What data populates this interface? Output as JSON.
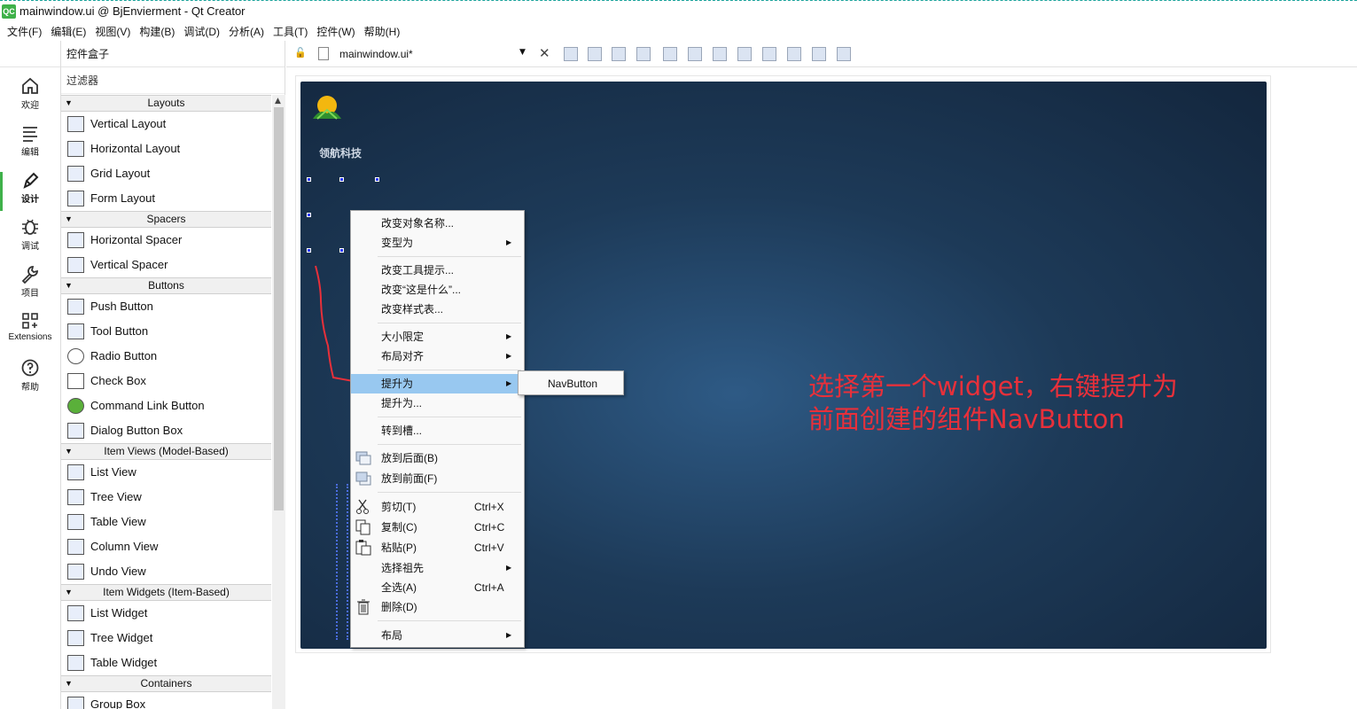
{
  "window": {
    "title": "mainwindow.ui @ BjEnvierment - Qt Creator",
    "logo": "QC"
  },
  "menubar": [
    "文件(F)",
    "编辑(E)",
    "视图(V)",
    "构建(B)",
    "调试(D)",
    "分析(A)",
    "工具(T)",
    "控件(W)",
    "帮助(H)"
  ],
  "modes": [
    {
      "label": "欢迎",
      "icon": "home-icon"
    },
    {
      "label": "编辑",
      "icon": "edit-lines-icon"
    },
    {
      "label": "设计",
      "icon": "pen-icon",
      "active": true
    },
    {
      "label": "调试",
      "icon": "bug-icon"
    },
    {
      "label": "项目",
      "icon": "wrench-icon"
    },
    {
      "label": "Extensions",
      "icon": "extensions-icon"
    },
    {
      "label": "帮助",
      "icon": "help-icon"
    }
  ],
  "widgetbox": {
    "title": "控件盒子",
    "filter": "过滤器",
    "categories": [
      {
        "name": "Layouts",
        "items": [
          "Vertical Layout",
          "Horizontal Layout",
          "Grid Layout",
          "Form Layout"
        ]
      },
      {
        "name": "Spacers",
        "items": [
          "Horizontal Spacer",
          "Vertical Spacer"
        ]
      },
      {
        "name": "Buttons",
        "items": [
          "Push Button",
          "Tool Button",
          "Radio Button",
          "Check Box",
          "Command Link Button",
          "Dialog Button Box"
        ]
      },
      {
        "name": "Item Views (Model-Based)",
        "items": [
          "List View",
          "Tree View",
          "Table View",
          "Column View",
          "Undo View"
        ]
      },
      {
        "name": "Item Widgets (Item-Based)",
        "items": [
          "List Widget",
          "Tree Widget",
          "Table Widget"
        ]
      },
      {
        "name": "Containers",
        "items": [
          "Group Box"
        ]
      }
    ]
  },
  "editor": {
    "file": "mainwindow.ui*"
  },
  "form": {
    "company": "领航科技"
  },
  "context_menu": {
    "items": [
      {
        "label": "改变对象名称..."
      },
      {
        "label": "变型为",
        "submenu": true
      },
      {
        "label": "改变工具提示..."
      },
      {
        "label": "改变“这是什么”..."
      },
      {
        "label": "改变样式表..."
      },
      {
        "label": "大小限定",
        "submenu": true
      },
      {
        "label": "布局对齐",
        "submenu": true
      },
      {
        "label": "提升为",
        "submenu": true,
        "highlighted": true
      },
      {
        "label": "提升为..."
      },
      {
        "label": "转到槽..."
      },
      {
        "label": "放到后面(B)"
      },
      {
        "label": "放到前面(F)"
      },
      {
        "label": "剪切(T)",
        "shortcut": "Ctrl+X"
      },
      {
        "label": "复制(C)",
        "shortcut": "Ctrl+C"
      },
      {
        "label": "粘贴(P)",
        "shortcut": "Ctrl+V"
      },
      {
        "label": "选择祖先",
        "submenu": true
      },
      {
        "label": "全选(A)",
        "shortcut": "Ctrl+A"
      },
      {
        "label": "删除(D)"
      },
      {
        "label": "布局",
        "submenu": true
      }
    ],
    "submenu_item": "NavButton"
  },
  "annotation": {
    "line1": "选择第一个widget，右键提升为",
    "line2": "前面创建的组件NavButton",
    "color": "#e8303a"
  }
}
